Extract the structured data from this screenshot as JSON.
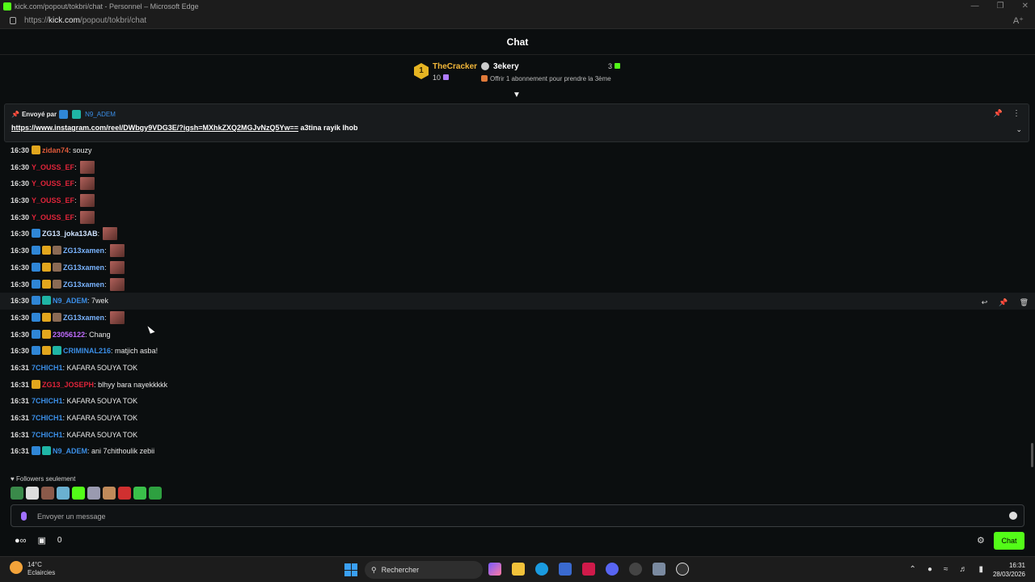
{
  "window": {
    "title": "kick.com/popout/tokbri/chat - Personnel – Microsoft Edge"
  },
  "address": {
    "prefix": "https://",
    "host": "kick.com",
    "path": "/popout/tokbri/chat"
  },
  "header": {
    "title": "Chat"
  },
  "leaderboard": {
    "rank": "1",
    "first_name": "TheCracker",
    "first_count": "10",
    "second_name": "3ekery",
    "second_count": "3",
    "offer": "Offrir 1 abonnement pour prendre la 3ème"
  },
  "pinned": {
    "sent_by": "Envoyé par",
    "user": "N9_ADEM",
    "link": "https://www.instagram.com/reel/DWbgy9VDG3E/?igsh=MXhkZXQ2MGJvNzQ5Yw==",
    "text": " a3tina rayik lhob"
  },
  "messages": [
    {
      "time": "16:30",
      "user": "zidan74",
      "color": "#e05a3a",
      "text": ": souzy",
      "badges": [
        "b-gold"
      ],
      "emote": false
    },
    {
      "time": "16:30",
      "user": "Y_OUSS_EF",
      "color": "#e0243a",
      "text": ":",
      "badges": [],
      "emote": true
    },
    {
      "time": "16:30",
      "user": "Y_OUSS_EF",
      "color": "#e0243a",
      "text": ":",
      "badges": [],
      "emote": true
    },
    {
      "time": "16:30",
      "user": "Y_OUSS_EF",
      "color": "#e0243a",
      "text": ":",
      "badges": [],
      "emote": true
    },
    {
      "time": "16:30",
      "user": "Y_OUSS_EF",
      "color": "#e0243a",
      "text": ":",
      "badges": [],
      "emote": true
    },
    {
      "time": "16:30",
      "user": "ZG13_joka13AB",
      "color": "#cfe3ff",
      "text": ":",
      "badges": [
        "b-blue"
      ],
      "emote": true
    },
    {
      "time": "16:30",
      "user": "ZG13xamen",
      "color": "#7ab4ff",
      "text": ":",
      "badges": [
        "b-blue",
        "b-gold",
        "b-face"
      ],
      "emote": true
    },
    {
      "time": "16:30",
      "user": "ZG13xamen",
      "color": "#7ab4ff",
      "text": ":",
      "badges": [
        "b-blue",
        "b-gold",
        "b-face"
      ],
      "emote": true
    },
    {
      "time": "16:30",
      "user": "ZG13xamen",
      "color": "#7ab4ff",
      "text": ":",
      "badges": [
        "b-blue",
        "b-gold",
        "b-face"
      ],
      "emote": true
    },
    {
      "time": "16:30",
      "user": "N9_ADEM",
      "color": "#3a8ee6",
      "text": ": 7wek",
      "badges": [
        "b-blue",
        "b-teal"
      ],
      "emote": false,
      "highlight": true
    },
    {
      "time": "16:30",
      "user": "ZG13xamen",
      "color": "#7ab4ff",
      "text": ":",
      "badges": [
        "b-blue",
        "b-gold",
        "b-face"
      ],
      "emote": true
    },
    {
      "time": "16:30",
      "user": "23056122",
      "color": "#c06cff",
      "text": ": Chang",
      "badges": [
        "b-blue",
        "b-gold"
      ],
      "emote": false
    },
    {
      "time": "16:30",
      "user": "CRIMINAL216",
      "color": "#3a8ee6",
      "text": ": matjich asba!",
      "badges": [
        "b-blue",
        "b-gold",
        "b-teal"
      ],
      "emote": false
    },
    {
      "time": "16:31",
      "user": "7CHICH1",
      "color": "#3a8ee6",
      "text": ": KAFARA 5OUYA TOK",
      "badges": [],
      "emote": false
    },
    {
      "time": "16:31",
      "user": "ZG13_JOSEPH",
      "color": "#e0243a",
      "text": ": blhyy bara nayekkkkk",
      "badges": [
        "b-gold"
      ],
      "emote": false
    },
    {
      "time": "16:31",
      "user": "7CHICH1",
      "color": "#3a8ee6",
      "text": ": KAFARA 5OUYA TOK",
      "badges": [],
      "emote": false
    },
    {
      "time": "16:31",
      "user": "7CHICH1",
      "color": "#3a8ee6",
      "text": ": KAFARA 5OUYA TOK",
      "badges": [],
      "emote": false
    },
    {
      "time": "16:31",
      "user": "7CHICH1",
      "color": "#3a8ee6",
      "text": ": KAFARA 5OUYA TOK",
      "badges": [],
      "emote": false
    },
    {
      "time": "16:31",
      "user": "N9_ADEM",
      "color": "#3a8ee6",
      "text": ": ani 7chithoulik zebii",
      "badges": [
        "b-blue",
        "b-teal"
      ],
      "emote": false
    }
  ],
  "followers_only": "Followers seulement",
  "input": {
    "placeholder": "Envoyer un message"
  },
  "footer": {
    "viewers": "0",
    "chat_button": "Chat"
  },
  "taskbar": {
    "temp": "14°C",
    "weather": "Eclaircies",
    "search": "Rechercher",
    "time": "16:31",
    "date": "28/03/2026"
  },
  "colors": {
    "accent": "#53fc18"
  }
}
